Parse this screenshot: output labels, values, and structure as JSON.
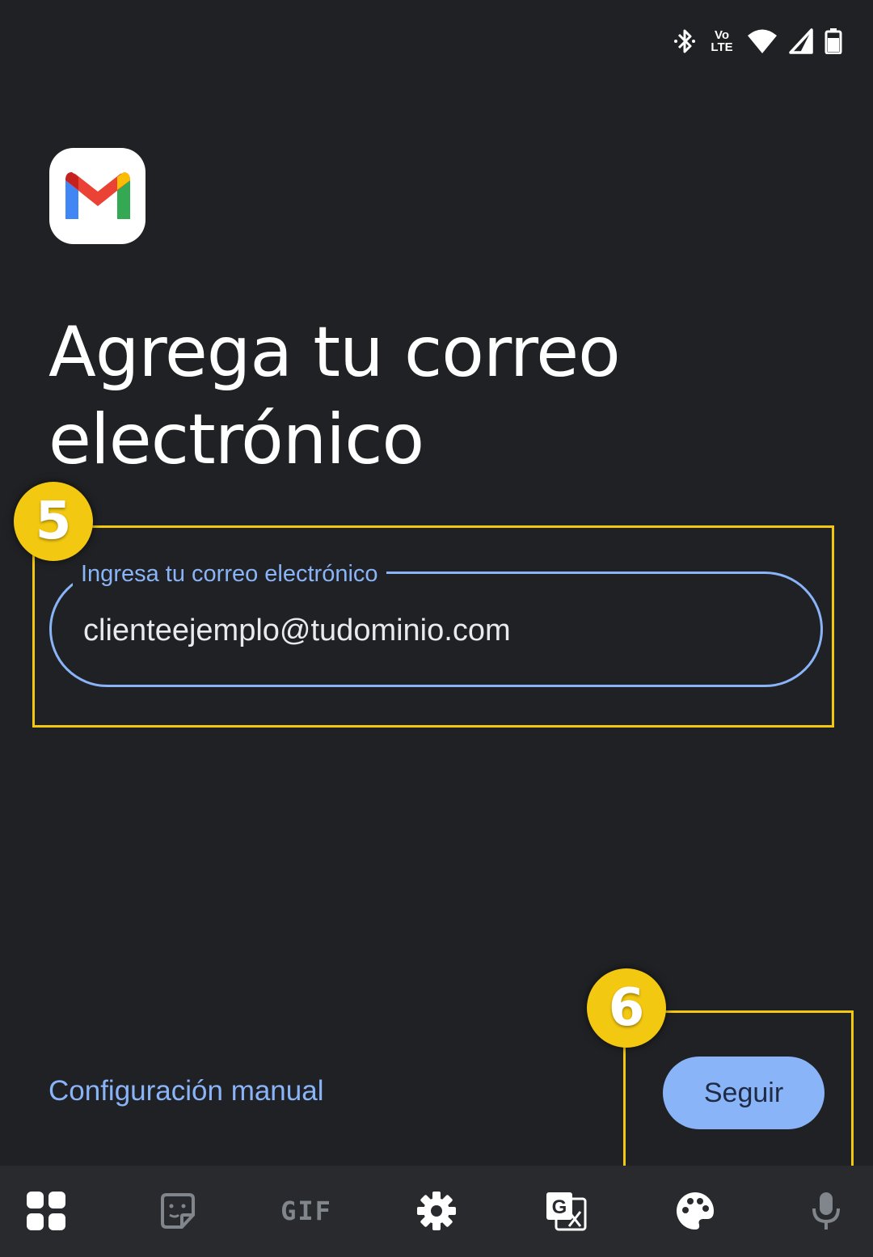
{
  "status_bar": {
    "icons": [
      "bluetooth-icon",
      "volte-icon",
      "wifi-icon",
      "signal-icon",
      "battery-icon"
    ],
    "volte_text_top": "Vo",
    "volte_text_bottom": "LTE"
  },
  "header": {
    "logo": "gmail-logo"
  },
  "title": "Agrega tu correo electrónico",
  "annotations": {
    "step_email": "5",
    "step_button": "6",
    "color": "#f2c811"
  },
  "email_field": {
    "label": "Ingresa tu correo electrónico",
    "value": "clienteejemplo@tudominio.com"
  },
  "actions": {
    "manual_config_label": "Configuración manual",
    "next_label": "Seguir"
  },
  "keyboard_toolbar": {
    "items": [
      "apps-grid-icon",
      "sticker-icon",
      "gif-button",
      "settings-icon",
      "translate-icon",
      "palette-icon",
      "microphone-icon"
    ],
    "gif_label": "GIF"
  },
  "colors": {
    "background": "#202124",
    "accent": "#8ab4f8",
    "toolbar": "#282a2d"
  }
}
